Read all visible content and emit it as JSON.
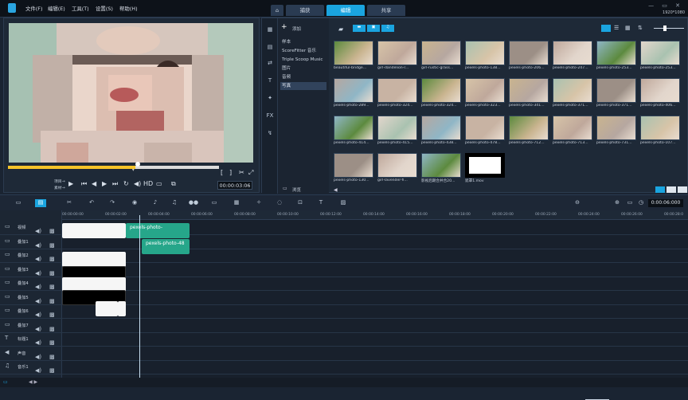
{
  "menu": [
    "文件(F)",
    "编辑(E)",
    "工具(T)",
    "设置(S)",
    "帮助(H)"
  ],
  "tabs": [
    {
      "label": "捕获",
      "active": false
    },
    {
      "label": "编辑",
      "active": true
    },
    {
      "label": "共享",
      "active": false
    }
  ],
  "window": {
    "controls": "— ▭ ✕",
    "resolution": "1920*1080"
  },
  "preview": {
    "mode_project": "项目→",
    "mode_clip": "素材→",
    "timecode": "00:00:03:06"
  },
  "library": {
    "add_label": "添加",
    "browse_label": "浏览",
    "folders": [
      "样本",
      "ScoreFitter 音乐",
      "Triple Scoop Music",
      "图片",
      "音频",
      "写真"
    ],
    "selected_folder": "写真",
    "thumbnails": [
      "beautiful-bridge...",
      "girl-dandelion-r...",
      "girl-rustic-grass...",
      "pexels-photo-138...",
      "pexels-photo-206...",
      "pexels-photo-247...",
      "pexels-photo-253...",
      "pexels-photo-253...",
      "pexels-photo-289...",
      "pexels-photo-324...",
      "pexels-photo-324...",
      "pexels-photo-323...",
      "pexels-photo-341...",
      "pexels-photo-371...",
      "pexels-photo-371...",
      "pexels-photo-406...",
      "pexels-photo-414...",
      "pexels-photo-415...",
      "pexels-photo-438...",
      "pexels-photo-478...",
      "pexels-photo-712...",
      "pexels-photo-713...",
      "pexels-photo-731...",
      "pexels-photo-107...",
      "pexels-photo-130...",
      "girl-lavender-fi...",
      "影视后期合并合20...",
      "遮罩1.mov"
    ]
  },
  "timeline": {
    "timecode": "0:00:06:000",
    "ruler": [
      "00:00:00:00",
      "00:00:02:00",
      "00:00:04:00",
      "00:00:06:00",
      "00:00:08:00",
      "00:00:10:00",
      "00:00:12:00",
      "00:00:14:00",
      "00:00:16:00",
      "00:00:18:00",
      "00:00:20:00",
      "00:00:22:00",
      "00:00:24:00",
      "00:00:26:00",
      "00:00:28:0"
    ],
    "tracks": [
      "视频",
      "叠加1",
      "叠加2",
      "叠加3",
      "叠加4",
      "叠加5",
      "叠加6",
      "叠加7",
      "标题1",
      "声音",
      "音乐1"
    ],
    "clip_labels": {
      "overlay1": "pexels-photo-",
      "overlay2": "pexels-photo-48"
    }
  },
  "colors": {
    "accent": "#1aa4df",
    "clip_green": "#26a68a",
    "scrub_yellow": "#f6c42a"
  }
}
